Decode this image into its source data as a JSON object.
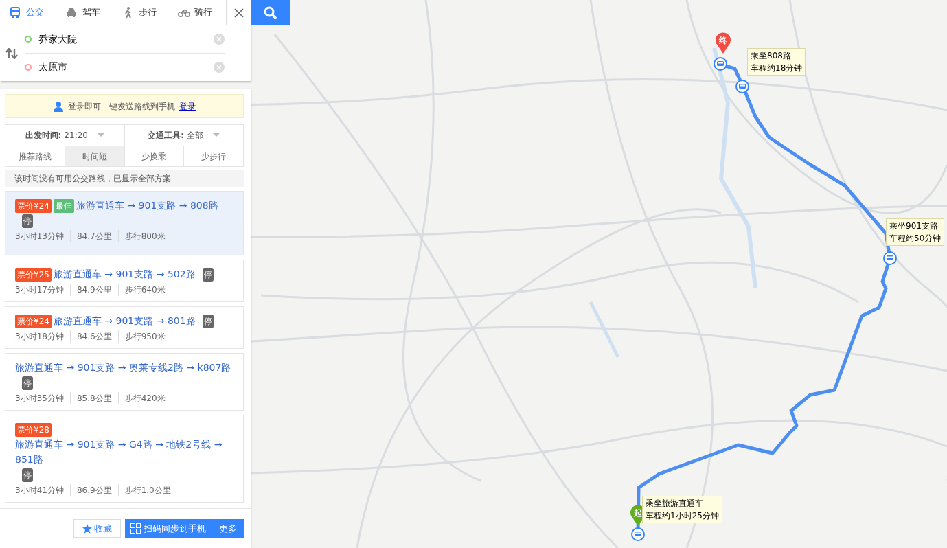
{
  "modes": [
    {
      "label": "公交",
      "kind": "bus",
      "selected": true
    },
    {
      "label": "驾车",
      "kind": "car",
      "selected": false
    },
    {
      "label": "步行",
      "kind": "walk",
      "selected": false
    },
    {
      "label": "骑行",
      "kind": "bike",
      "selected": false
    }
  ],
  "origin": {
    "value": "乔家大院"
  },
  "destination": {
    "value": "太原市"
  },
  "login_banner": {
    "text": "登录即可一键发送路线到手机",
    "link": "登录"
  },
  "filters": [
    {
      "label": "出发时间:",
      "value": "21:20"
    },
    {
      "label": "交通工具:",
      "value": "全部"
    }
  ],
  "sort_tabs": [
    {
      "label": "推荐路线",
      "selected": false
    },
    {
      "label": "时间短",
      "selected": true
    },
    {
      "label": "少换乘",
      "selected": false
    },
    {
      "label": "少步行",
      "selected": false
    }
  ],
  "notice": "该时间没有可用公交路线，已显示全部方案",
  "routes": [
    {
      "price": "票价¥24",
      "best": "最佳",
      "title": "旅游直通车 → 901支路 → 808路",
      "stop_badge": "停",
      "duration": "3小时13分钟",
      "distance": "84.7公里",
      "walk": "步行800米",
      "selected": true
    },
    {
      "price": "票价¥25",
      "title": "旅游直通车 → 901支路 → 502路",
      "stop_badge": "停",
      "duration": "3小时17分钟",
      "distance": "84.9公里",
      "walk": "步行640米",
      "selected": false
    },
    {
      "price": "票价¥24",
      "title": "旅游直通车 → 901支路 → 801路",
      "stop_badge": "停",
      "duration": "3小时18分钟",
      "distance": "84.6公里",
      "walk": "步行950米",
      "selected": false
    },
    {
      "title": "旅游直通车 → 901支路 → 奥莱专线2路 → k807路",
      "stop_badge": "停",
      "duration": "3小时35分钟",
      "distance": "85.8公里",
      "walk": "步行420米",
      "selected": false
    },
    {
      "price": "票价¥28",
      "title": "旅游直通车 → 901支路 → G4路 → 地铁2号线 → 851路",
      "stop_badge": "停",
      "duration": "3小时41分钟",
      "distance": "86.9公里",
      "walk": "步行1.0公里",
      "selected": false
    }
  ],
  "footer": {
    "favorite": "收藏",
    "sync": "扫码同步到手机",
    "more": "更多"
  },
  "map": {
    "start_marker": "起",
    "end_marker": "终",
    "callouts": [
      {
        "line1": "乘坐808路",
        "line2": "车程约18分钟"
      },
      {
        "line1": "乘坐901支路",
        "line2": "车程约50分钟"
      },
      {
        "line1": "乘坐旅游直通车",
        "line2": "车程约1小时25分钟"
      }
    ]
  }
}
